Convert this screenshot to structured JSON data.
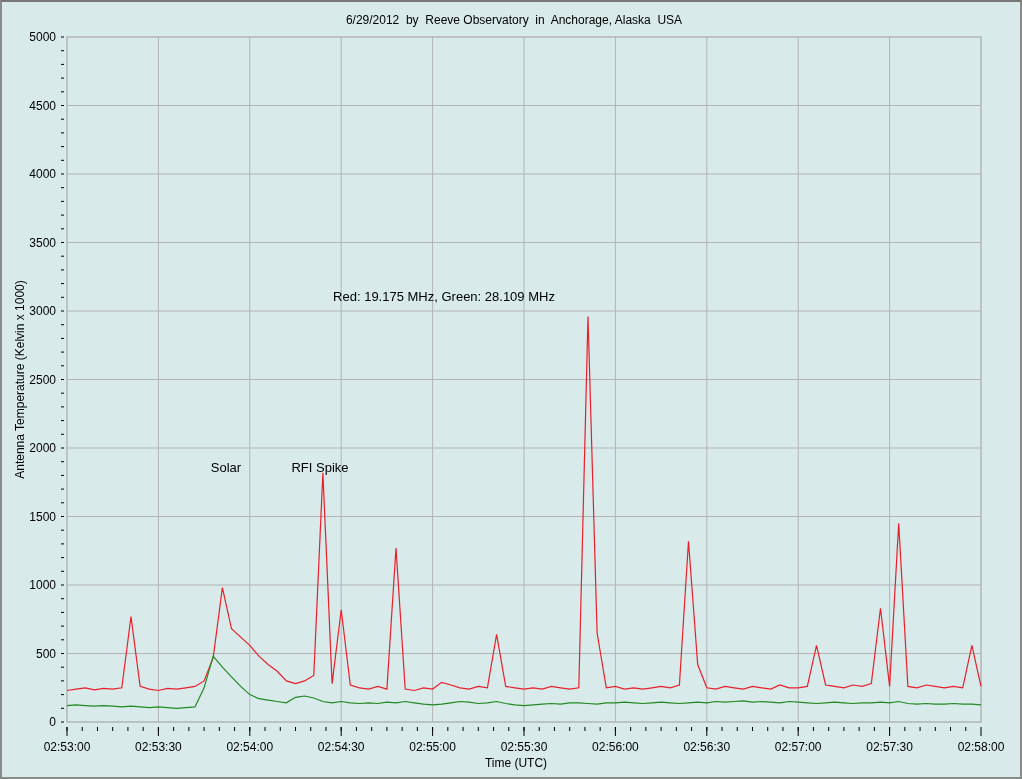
{
  "chart_data": {
    "type": "line",
    "title": "6/29/2012  by  Reeve Observatory  in  Anchorage, Alaska  USA",
    "xlabel": "Time (UTC)",
    "ylabel": "Antenna Temperature (Kelvin x 1000)",
    "categories": [
      "02:53:00",
      null,
      null,
      null,
      null,
      null,
      null,
      null,
      null,
      null,
      "02:53:30",
      null,
      null,
      null,
      null,
      null,
      null,
      null,
      null,
      null,
      "02:54:00",
      null,
      null,
      null,
      null,
      null,
      null,
      null,
      null,
      null,
      "02:54:30",
      null,
      null,
      null,
      null,
      null,
      null,
      null,
      null,
      null,
      "02:55:00",
      null,
      null,
      null,
      null,
      null,
      null,
      null,
      null,
      null,
      "02:55:30",
      null,
      null,
      null,
      null,
      null,
      null,
      null,
      null,
      null,
      "02:56:00",
      null,
      null,
      null,
      null,
      null,
      null,
      null,
      null,
      null,
      "02:56:30",
      null,
      null,
      null,
      null,
      null,
      null,
      null,
      null,
      null,
      "02:57:00",
      null,
      null,
      null,
      null,
      null,
      null,
      null,
      null,
      null,
      "02:57:30",
      null,
      null,
      null,
      null,
      null,
      null,
      null,
      null,
      null,
      "02:58:00"
    ],
    "series": [
      {
        "color": "#e8202c",
        "values": [
          230,
          240,
          250,
          235,
          245,
          240,
          250,
          770,
          260,
          240,
          230,
          245,
          240,
          250,
          260,
          300,
          470,
          980,
          680,
          620,
          560,
          480,
          420,
          370,
          300,
          280,
          300,
          340,
          1820,
          280,
          820,
          270,
          250,
          240,
          260,
          240,
          1270,
          240,
          230,
          250,
          240,
          290,
          270,
          250,
          240,
          260,
          250,
          640,
          260,
          250,
          240,
          250,
          240,
          260,
          250,
          240,
          250,
          2960,
          650,
          250,
          260,
          240,
          250,
          240,
          250,
          260,
          250,
          270,
          1320,
          420,
          250,
          240,
          260,
          250,
          240,
          260,
          250,
          240,
          270,
          250,
          250,
          260,
          560,
          270,
          260,
          250,
          270,
          260,
          280,
          830,
          260,
          1450,
          260,
          250,
          270,
          260,
          250,
          260,
          250,
          560,
          260
        ]
      },
      {
        "color": "#228822",
        "values": [
          120,
          125,
          120,
          115,
          120,
          115,
          110,
          115,
          110,
          105,
          110,
          105,
          100,
          105,
          110,
          250,
          480,
          400,
          330,
          260,
          200,
          170,
          160,
          150,
          140,
          180,
          190,
          175,
          150,
          140,
          150,
          140,
          135,
          140,
          135,
          145,
          140,
          150,
          140,
          130,
          125,
          130,
          140,
          150,
          145,
          135,
          140,
          150,
          135,
          125,
          120,
          125,
          130,
          135,
          130,
          140,
          140,
          135,
          130,
          140,
          140,
          145,
          140,
          135,
          140,
          145,
          140,
          135,
          140,
          145,
          140,
          150,
          145,
          150,
          155,
          145,
          150,
          145,
          140,
          150,
          145,
          140,
          135,
          140,
          145,
          140,
          135,
          140,
          140,
          145,
          140,
          150,
          135,
          130,
          135,
          130,
          130,
          135,
          130,
          130,
          125
        ]
      }
    ],
    "ylim": [
      0,
      5000
    ],
    "grid": true,
    "yticks": [
      0,
      500,
      1000,
      1500,
      2000,
      2500,
      3000,
      3500,
      4000,
      4500,
      5000
    ],
    "annotations": [
      "Red: 19.175 MHz, Green: 28.109 MHz",
      "Solar",
      "RFI Spike"
    ]
  }
}
